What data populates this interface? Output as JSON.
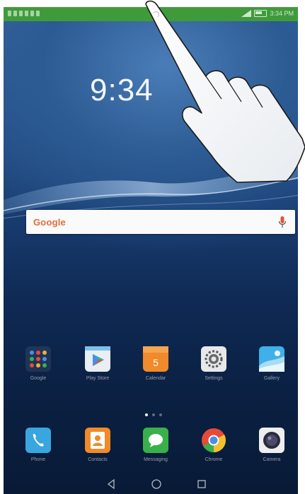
{
  "status_bar": {
    "time": "3:34 PM",
    "color": "#3f9b3a"
  },
  "lock_clock": {
    "time": "9:34"
  },
  "search": {
    "logo": "Google",
    "mic_icon": "microphone-icon"
  },
  "home_row": [
    {
      "name": "Google",
      "icon": "folder-icon"
    },
    {
      "name": "Play Store",
      "icon": "play-store-icon"
    },
    {
      "name": "Calendar",
      "icon": "calendar-icon",
      "day": "5"
    },
    {
      "name": "Settings",
      "icon": "settings-icon"
    },
    {
      "name": "Gallery",
      "icon": "gallery-icon"
    }
  ],
  "dock": [
    {
      "name": "Phone",
      "icon": "phone-icon"
    },
    {
      "name": "Contacts",
      "icon": "contacts-icon"
    },
    {
      "name": "Messaging",
      "icon": "messaging-icon"
    },
    {
      "name": "Chrome",
      "icon": "chrome-icon"
    },
    {
      "name": "Camera",
      "icon": "camera-icon"
    }
  ],
  "page_indicator": {
    "pages": 3,
    "current": 1
  },
  "nav": {
    "back": "back-icon",
    "home": "home-icon",
    "recents": "recents-icon"
  }
}
